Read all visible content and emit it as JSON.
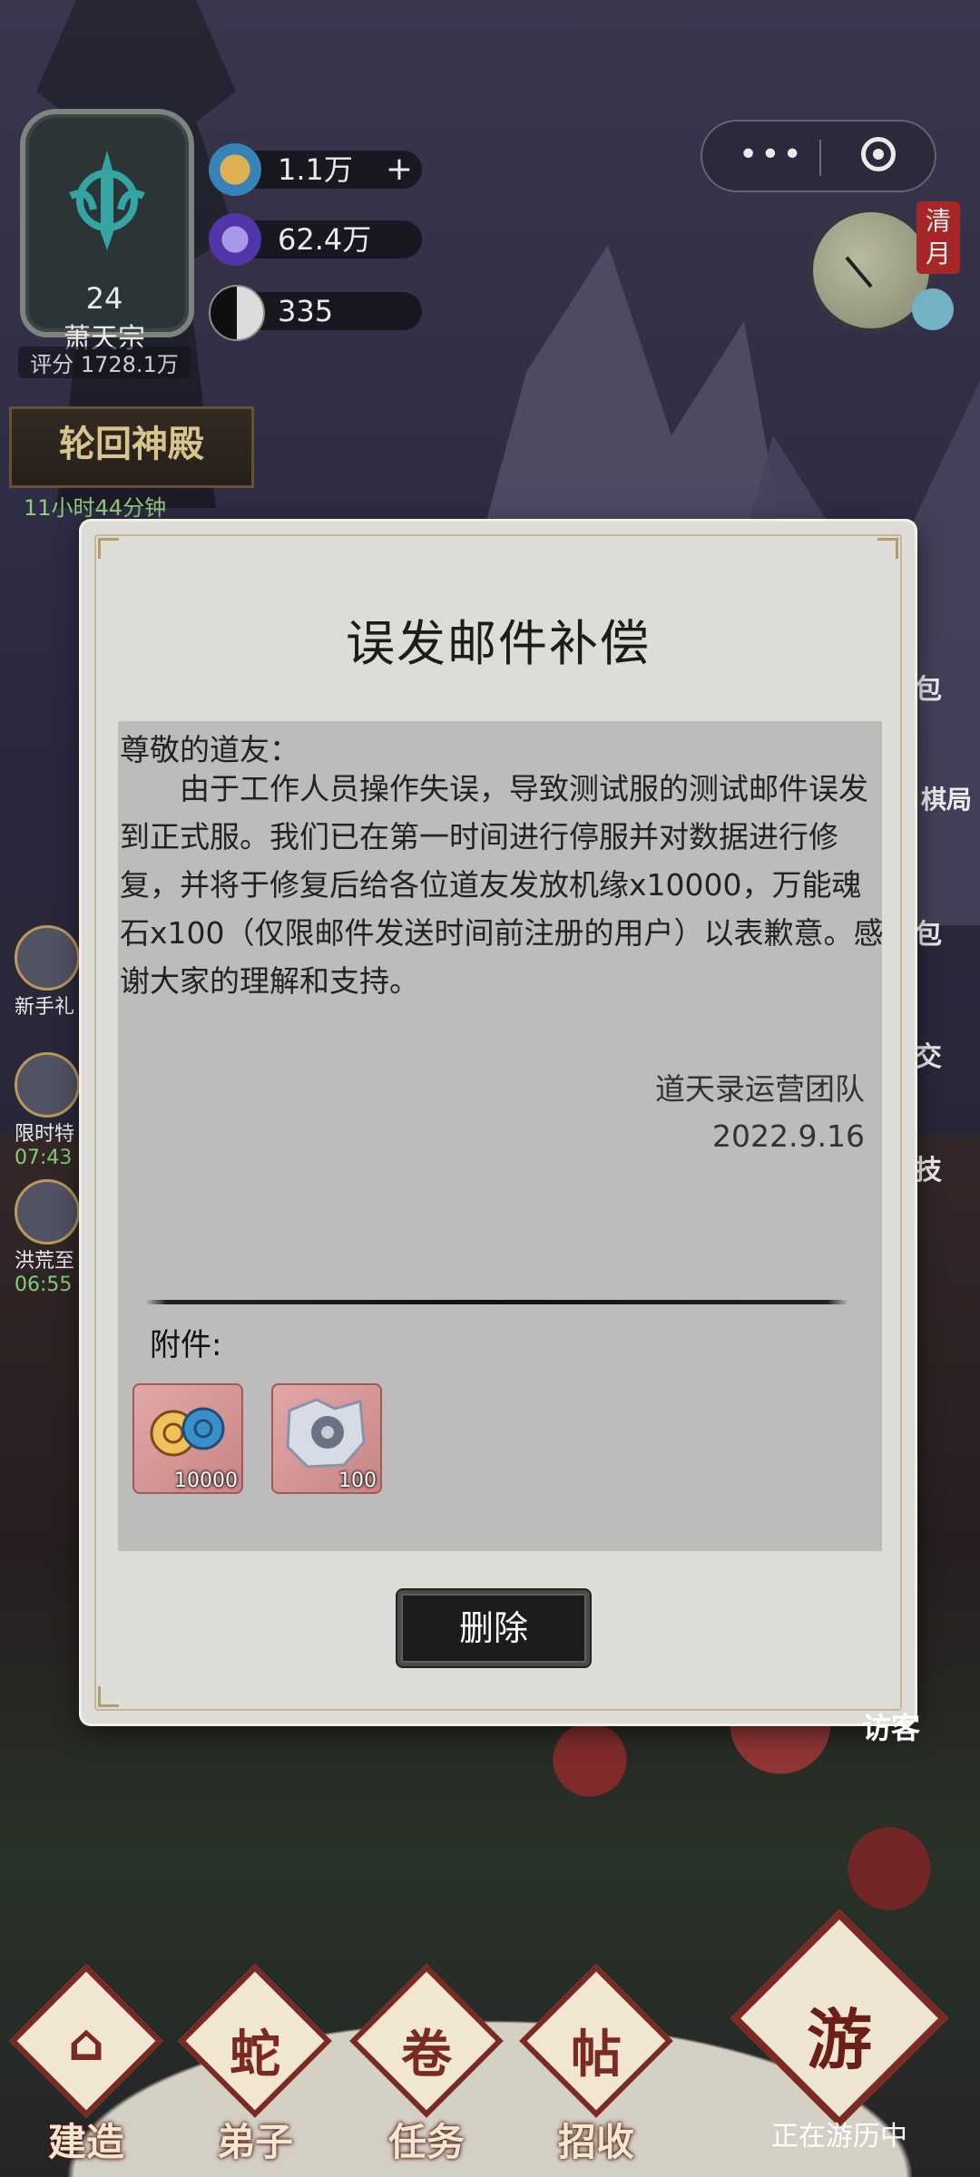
{
  "sect": {
    "level": "24",
    "name": "萧天宗",
    "score": "评分 1728.1万"
  },
  "resources": [
    {
      "value": "1.1万",
      "icon": "fortune-cloud-icon",
      "has_plus": true
    },
    {
      "value": "62.4万",
      "icon": "spirit-crystal-icon",
      "has_plus": false
    },
    {
      "value": "335",
      "icon": "yin-yang-icon",
      "has_plus": false
    }
  ],
  "time_of_day": "清月",
  "palace": {
    "title": "轮回神殿",
    "timer": "11小时44分钟"
  },
  "left_events": [
    {
      "label": "新手礼"
    },
    {
      "label": "限时特",
      "time": "07:43"
    },
    {
      "label": "洪荒至",
      "time": "06:55"
    }
  ],
  "right_menu": [
    "包",
    "棋局",
    "包",
    "交",
    "技"
  ],
  "mail": {
    "title": "误发邮件补偿",
    "greeting": "尊敬的道友：",
    "body": "由于工作人员操作失误，导致测试服的测试邮件误发到正式服。我们已在第一时间进行停服并对数据进行修复，并将于修复后给各位道友发放机缘x10000，万能魂石x100（仅限邮件发送时间前注册的用户）以表歉意。感谢大家的理解和支持。",
    "signature": "道天录运营团队",
    "date": "2022.9.16",
    "attachments_label": "附件:",
    "attachments": [
      {
        "name": "机缘",
        "icon": "fortune-cloud-icon",
        "qty": "10000"
      },
      {
        "name": "万能魂石",
        "icon": "soul-stone-icon",
        "qty": "100"
      }
    ],
    "delete_label": "删除"
  },
  "visitor_label": "访客",
  "nav": {
    "items": [
      {
        "label": "建造",
        "glyph": "⌂"
      },
      {
        "label": "弟子",
        "glyph": "蛇"
      },
      {
        "label": "任务",
        "glyph": "卷"
      },
      {
        "label": "招收",
        "glyph": "帖"
      }
    ],
    "travel_label": "正在游历中",
    "travel_glyph": "游"
  },
  "colors": {
    "accent": "#7a2a22",
    "modal_bg": "#dedcd6",
    "content_bg": "#bdbcba"
  }
}
